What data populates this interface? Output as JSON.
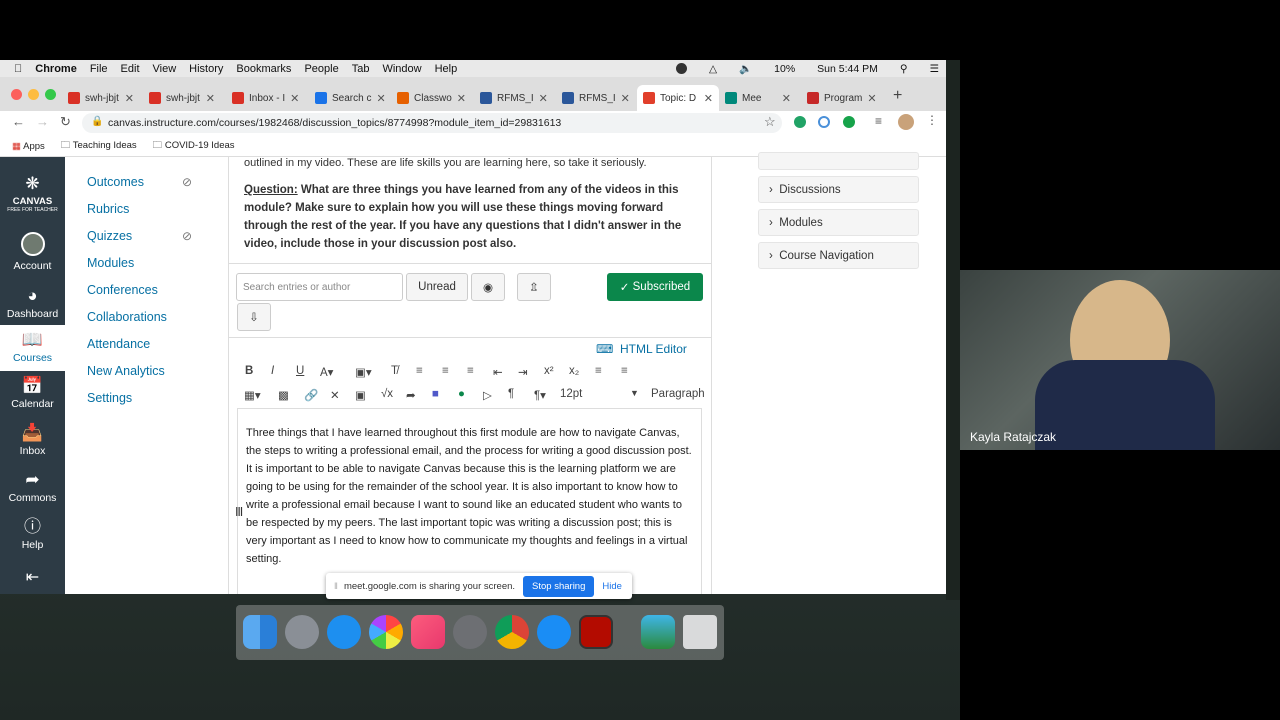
{
  "menubar": {
    "items": [
      "Chrome",
      "File",
      "Edit",
      "View",
      "History",
      "Bookmarks",
      "People",
      "Tab",
      "Window",
      "Help"
    ],
    "battery": "10%",
    "clock": "Sun 5:44 PM"
  },
  "tabs": [
    {
      "label": "swh-jbjt",
      "color": "#d93025"
    },
    {
      "label": "swh-jbjt",
      "color": "#d93025"
    },
    {
      "label": "Inbox - I",
      "color": "#d93025"
    },
    {
      "label": "Search c",
      "color": "#1a73e8"
    },
    {
      "label": "Classwo",
      "color": "#e66000"
    },
    {
      "label": "RFMS_I",
      "color": "#2b579a"
    },
    {
      "label": "RFMS_I",
      "color": "#2b579a"
    },
    {
      "label": "Topic: D",
      "color": "#e13f2b"
    },
    {
      "label": "Mee",
      "color": "#00897b"
    },
    {
      "label": "Program",
      "color": "#c62828"
    }
  ],
  "url": "canvas.instructure.com/courses/1982468/discussion_topics/8774998?module_item_id=29831613",
  "bookmarks": [
    "Apps",
    "Teaching Ideas",
    "COVID-19 Ideas"
  ],
  "global_nav": {
    "logo": "CANVAS",
    "logo_sub": "FREE FOR TEACHER",
    "items": [
      "Account",
      "Dashboard",
      "Courses",
      "Calendar",
      "Inbox",
      "Commons",
      "Help"
    ]
  },
  "course_nav": [
    "Outcomes",
    "Rubrics",
    "Quizzes",
    "Modules",
    "Conferences",
    "Collaborations",
    "Attendance",
    "New Analytics",
    "Settings"
  ],
  "discussion": {
    "prev_line": "outlined in my video. These are life skills you are learning here, so take it seriously.",
    "question_label": "Question:",
    "question_text": " What are three things you have learned from any of the videos in this module? Make sure to explain how you will use these things moving forward through the rest of the year. If you have any questions that I didn't answer in the video, include those in your discussion post also."
  },
  "toolbar": {
    "search_placeholder": "Search entries or author",
    "unread": "Unread",
    "subscribed": "Subscribed"
  },
  "editor": {
    "html_editor": "HTML Editor",
    "font_size": "12pt",
    "block": "Paragraph",
    "body": "Three things that I have learned throughout this first module are how to navigate Canvas, the steps to writing a professional email, and the process for writing a good discussion post. It is important to be able to navigate Canvas because this is the learning platform we are going to be using for the remainder of the school year. It is also important to know how to write a professional email because I want to sound like an educated student who wants to be respected by my peers. The last important topic was writing a discussion post; this is very important as I need to know how to communicate my thoughts and feelings in a virtual setting."
  },
  "right_panel": [
    "Discussions",
    "Modules",
    "Course Navigation"
  ],
  "share_banner": {
    "text": "meet.google.com is sharing your screen.",
    "stop": "Stop sharing",
    "hide": "Hide"
  },
  "webcam": {
    "name": "Kayla Ratajczak"
  }
}
